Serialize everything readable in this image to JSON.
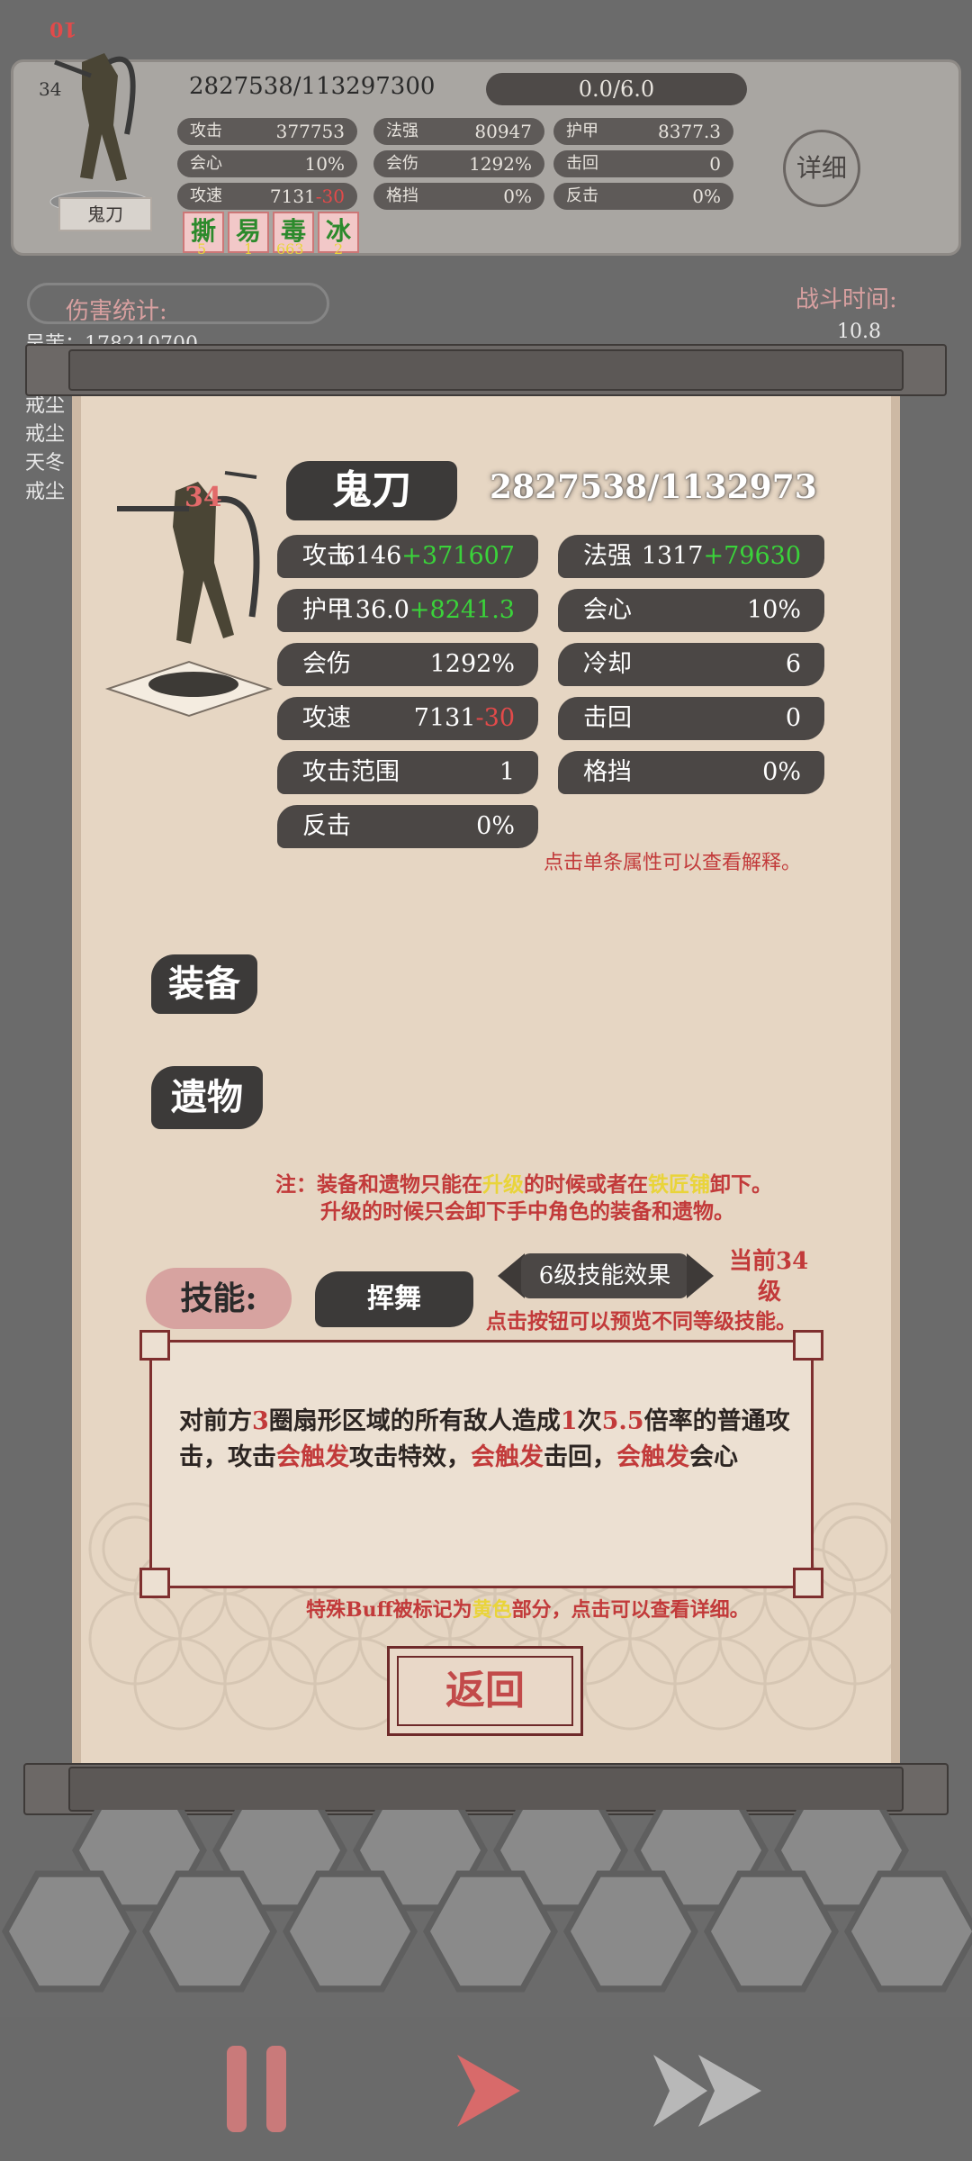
{
  "top_panel": {
    "corner_label": "10",
    "level": "34",
    "hp": "2827538/113297300",
    "mp": "0.0/6.0",
    "unit_name": "鬼刀",
    "detail_label": "详细",
    "stats": [
      {
        "key": "攻击",
        "value": "377753"
      },
      {
        "key": "法强",
        "value": "80947"
      },
      {
        "key": "护甲",
        "value": "8377.3"
      },
      {
        "key": "会心",
        "value": "10%"
      },
      {
        "key": "会伤",
        "value": "1292%"
      },
      {
        "key": "击回",
        "value": "0"
      },
      {
        "key": "攻速",
        "value": "7131",
        "value_red": "-30"
      },
      {
        "key": "格挡",
        "value": "0%"
      },
      {
        "key": "反击",
        "value": "0%"
      }
    ],
    "buffs": [
      {
        "label": "撕",
        "count": "5"
      },
      {
        "label": "易",
        "count": "1"
      },
      {
        "label": "毒",
        "count": "663"
      },
      {
        "label": "冰",
        "count": "2"
      }
    ]
  },
  "background": {
    "damage_stats_label": "伤害统计:",
    "battle_time_label": "战斗时间:",
    "battle_time_value": "10.8",
    "rows": [
      "吴茉：178210700",
      "戒尘",
      "戒尘",
      "天冬",
      "戒尘"
    ]
  },
  "panel": {
    "name": "鬼刀",
    "level": "34",
    "hp": "2827538/1132973",
    "stats": [
      {
        "key": "攻击",
        "base": "6146",
        "bonus": "+371607"
      },
      {
        "key": "法强",
        "base": "1317",
        "bonus": "+79630"
      },
      {
        "key": "护甲",
        "base": "136.0",
        "bonus": "+8241.3"
      },
      {
        "key": "会心",
        "base": "10%"
      },
      {
        "key": "会伤",
        "base": "1292%"
      },
      {
        "key": "冷却",
        "base": "6"
      },
      {
        "key": "攻速",
        "base": "7131",
        "bonus_red": "-30"
      },
      {
        "key": "击回",
        "base": "0"
      },
      {
        "key": "攻击范围",
        "base": "1"
      },
      {
        "key": "格挡",
        "base": "0%"
      },
      {
        "key": "反击",
        "base": "0%"
      }
    ],
    "hint_attr": "点击单条属性可以查看解释。",
    "equip_label": "装备",
    "relic_label": "遗物",
    "note_prefix": "注：装备和遗物只能在",
    "note_upgrade": "升级",
    "note_mid": "的时候或者在",
    "note_smith": "铁匠铺",
    "note_suffix": "卸下。",
    "note_line2": "升级的时候只会卸下手中角色的装备和遗物。",
    "skill_label": "技能:",
    "skill_name": "挥舞",
    "skill_level_effect": "6级技能效果",
    "current_level_line1": "当前34",
    "current_level_line2": "级",
    "skill_hint": "点击按钮可以预览不同等级技能。",
    "desc": {
      "p1": "对前方",
      "n1": "3",
      "p2": "圈扇形区域的所有敌人造成",
      "n2": "1",
      "p3": "次",
      "n3": "5.5",
      "p4": "倍率的普通攻击，攻击",
      "k1": "会触发",
      "p5": "攻击特效，",
      "k2": "会触发",
      "p6": "击回，",
      "k3": "会触发",
      "p7": "会心"
    },
    "buff_hint_prefix": "特殊Buff被标记为",
    "buff_hint_yellow": "黄色",
    "buff_hint_suffix": "部分，点击可以查看详细。",
    "return_label": "返回"
  },
  "colors": {
    "accent_red": "#c23a3a",
    "bonus_green": "#3ad33a",
    "highlight_yellow": "#e9d43a"
  }
}
